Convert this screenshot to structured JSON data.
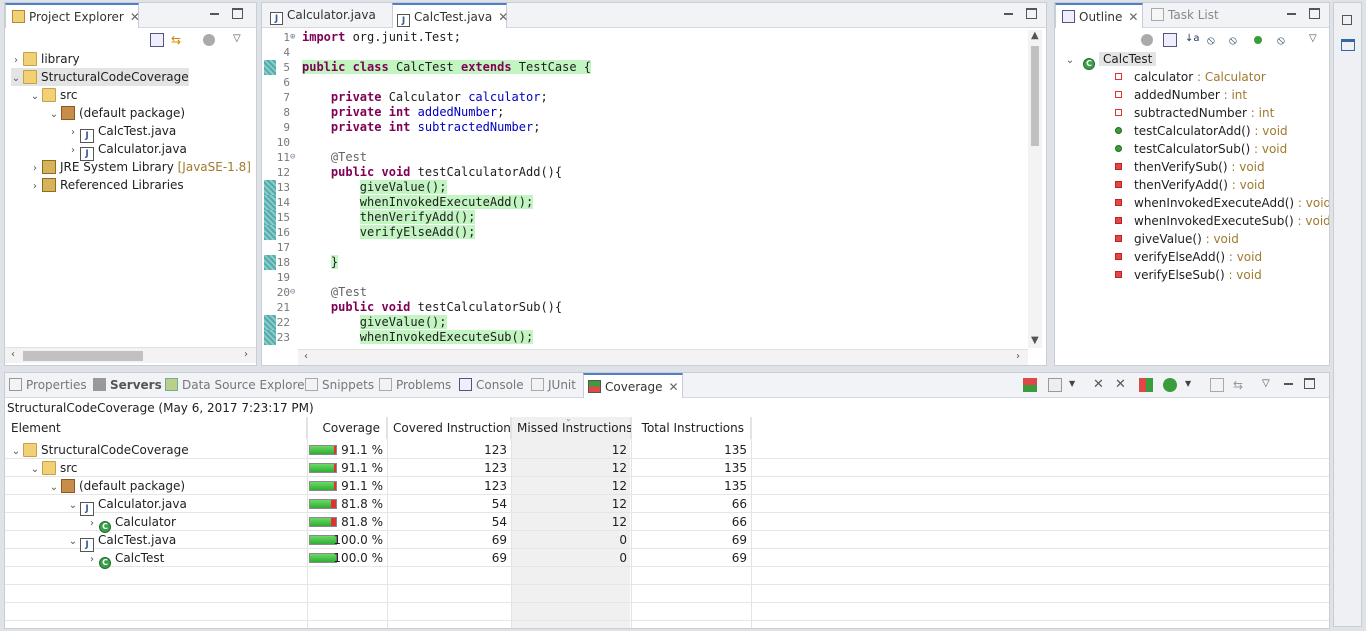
{
  "project_explorer": {
    "tab_label": "Project Explorer",
    "items": [
      {
        "label": "library",
        "deco": ""
      },
      {
        "label": "StructuralCodeCoverage",
        "deco": ""
      },
      {
        "label": "src",
        "deco": ""
      },
      {
        "label": "(default package)",
        "deco": ""
      },
      {
        "label": "CalcTest.java",
        "deco": ""
      },
      {
        "label": "Calculator.java",
        "deco": ""
      },
      {
        "label": "JRE System Library",
        "deco": "[JavaSE-1.8]"
      },
      {
        "label": "Referenced Libraries",
        "deco": ""
      }
    ]
  },
  "editor": {
    "tabs": [
      {
        "label": "Calculator.java"
      },
      {
        "label": "CalcTest.java"
      }
    ],
    "lines": [
      {
        "n": "1",
        "text": "import org.junit.Test;"
      },
      {
        "n": "4",
        "text": ""
      },
      {
        "n": "5",
        "text": "public class CalcTest extends TestCase {"
      },
      {
        "n": "6",
        "text": ""
      },
      {
        "n": "7",
        "text": "    private Calculator calculator;"
      },
      {
        "n": "8",
        "text": "    private int addedNumber;"
      },
      {
        "n": "9",
        "text": "    private int subtractedNumber;"
      },
      {
        "n": "10",
        "text": ""
      },
      {
        "n": "11",
        "text": "    @Test"
      },
      {
        "n": "12",
        "text": "    public void testCalculatorAdd(){"
      },
      {
        "n": "13",
        "text": "        giveValue();"
      },
      {
        "n": "14",
        "text": "        whenInvokedExecuteAdd();"
      },
      {
        "n": "15",
        "text": "        thenVerifyAdd();"
      },
      {
        "n": "16",
        "text": "        verifyElseAdd();"
      },
      {
        "n": "17",
        "text": ""
      },
      {
        "n": "18",
        "text": "    }"
      },
      {
        "n": "19",
        "text": ""
      },
      {
        "n": "20",
        "text": "    @Test"
      },
      {
        "n": "21",
        "text": "    public void testCalculatorSub(){"
      },
      {
        "n": "22",
        "text": "        giveValue();"
      },
      {
        "n": "23",
        "text": "        whenInvokedExecuteSub();"
      }
    ]
  },
  "outline": {
    "tab_label": "Outline",
    "tab2_label": "Task List",
    "root": "CalcTest",
    "members": [
      {
        "name": "calculator",
        "type": " : Calculator",
        "kind": "field"
      },
      {
        "name": "addedNumber",
        "type": " : int",
        "kind": "field"
      },
      {
        "name": "subtractedNumber",
        "type": " : int",
        "kind": "field"
      },
      {
        "name": "testCalculatorAdd()",
        "type": " : void",
        "kind": "public"
      },
      {
        "name": "testCalculatorSub()",
        "type": " : void",
        "kind": "public"
      },
      {
        "name": "thenVerifySub()",
        "type": " : void",
        "kind": "private"
      },
      {
        "name": "thenVerifyAdd()",
        "type": " : void",
        "kind": "private"
      },
      {
        "name": "whenInvokedExecuteAdd()",
        "type": " : void",
        "kind": "private"
      },
      {
        "name": "whenInvokedExecuteSub()",
        "type": " : void",
        "kind": "private"
      },
      {
        "name": "giveValue()",
        "type": " : void",
        "kind": "private"
      },
      {
        "name": "verifyElseAdd()",
        "type": " : void",
        "kind": "private"
      },
      {
        "name": "verifyElseSub()",
        "type": " : void",
        "kind": "private"
      }
    ]
  },
  "bottom": {
    "tabs": [
      {
        "label": "Properties"
      },
      {
        "label": "Servers"
      },
      {
        "label": "Data Source Explorer"
      },
      {
        "label": "Snippets"
      },
      {
        "label": "Problems"
      },
      {
        "label": "Console"
      },
      {
        "label": "JUnit"
      },
      {
        "label": "Coverage"
      }
    ],
    "session": "StructuralCodeCoverage (May 6, 2017 7:23:17 PM)",
    "columns": [
      "Element",
      "Coverage",
      "Covered Instructions",
      "Missed Instructions",
      "Total Instructions"
    ],
    "rows": [
      {
        "element": "StructuralCodeCoverage",
        "coverage": "91.1 %",
        "pct": 91.1,
        "covered": "123",
        "missed": "12",
        "total": "135"
      },
      {
        "element": "src",
        "coverage": "91.1 %",
        "pct": 91.1,
        "covered": "123",
        "missed": "12",
        "total": "135"
      },
      {
        "element": "(default package)",
        "coverage": "91.1 %",
        "pct": 91.1,
        "covered": "123",
        "missed": "12",
        "total": "135"
      },
      {
        "element": "Calculator.java",
        "coverage": "81.8 %",
        "pct": 81.8,
        "covered": "54",
        "missed": "12",
        "total": "66"
      },
      {
        "element": "Calculator",
        "coverage": "81.8 %",
        "pct": 81.8,
        "covered": "54",
        "missed": "12",
        "total": "66"
      },
      {
        "element": "CalcTest.java",
        "coverage": "100.0 %",
        "pct": 100.0,
        "covered": "69",
        "missed": "0",
        "total": "69"
      },
      {
        "element": "CalcTest",
        "coverage": "100.0 %",
        "pct": 100.0,
        "covered": "69",
        "missed": "0",
        "total": "69"
      }
    ]
  }
}
